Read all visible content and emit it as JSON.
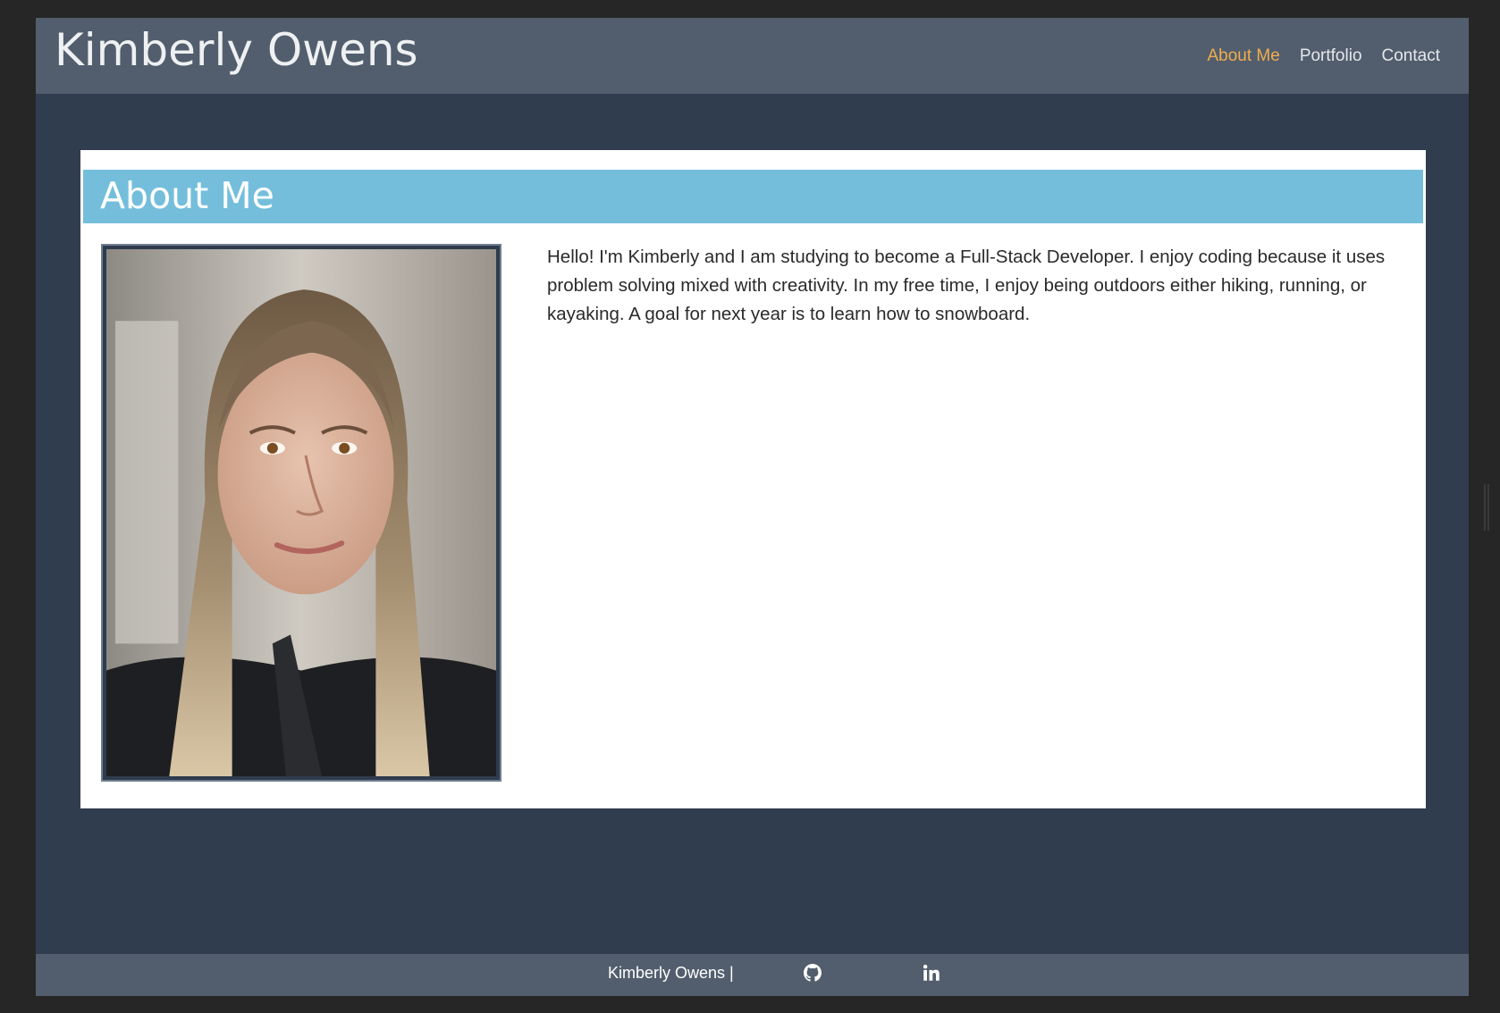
{
  "header": {
    "site_title": "Kimberly Owens",
    "nav": [
      {
        "label": "About Me",
        "active": true
      },
      {
        "label": "Portfolio",
        "active": false
      },
      {
        "label": "Contact",
        "active": false
      }
    ]
  },
  "about": {
    "heading": "About Me",
    "bio": "Hello! I'm Kimberly and I am studying to become a Full-Stack Developer. I enjoy coding because it uses problem solving mixed with creativity. In my free time, I enjoy being outdoors either hiking, running, or kayaking. A goal for next year is to learn how to snowboard.",
    "photo_icon": "profile-photo"
  },
  "footer": {
    "name": "Kimberly Owens |",
    "icons": [
      "github-icon",
      "linkedin-icon"
    ]
  },
  "colors": {
    "page_bg": "#303d4f",
    "header_bg": "#525e6d",
    "section_header_bg": "#74bedc",
    "active_nav": "#f0ad4e"
  }
}
